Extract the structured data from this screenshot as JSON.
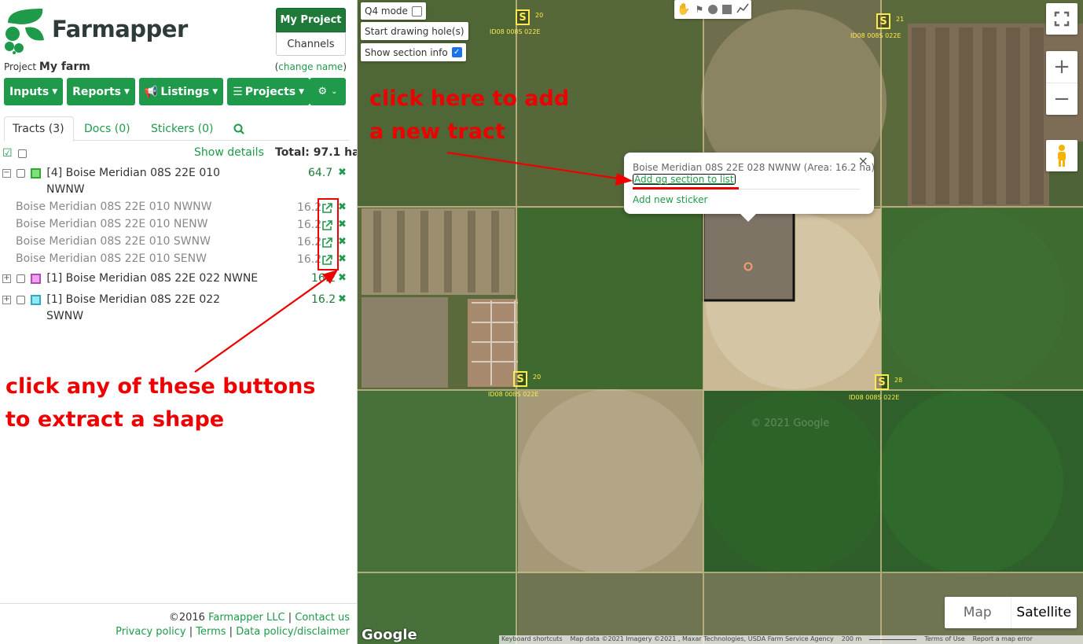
{
  "brand": {
    "name": "Farmapper"
  },
  "header": {
    "my_project": "My Project",
    "channels": "Channels"
  },
  "project": {
    "label": "Project",
    "name": "My farm",
    "change_name_prefix": "(",
    "change_name": "change name",
    "change_name_suffix": ")"
  },
  "menu": {
    "items": [
      "Inputs",
      "Reports",
      "Listings",
      "Projects"
    ]
  },
  "tabs": [
    {
      "label": "Tracts (3)"
    },
    {
      "label": "Docs  (0)"
    },
    {
      "label": "Stickers  (0)"
    }
  ],
  "tract_list": {
    "show_details": "Show details",
    "total_label": "Total: 97.1 ha",
    "groups": [
      {
        "expander": "−",
        "name_line1": "[4] Boise Meridian 08S 22E 010",
        "name_line2": "NWNW",
        "area": "64.7",
        "color": "#4bd04b"
      },
      {
        "expander": "+",
        "name_line1": "[1] Boise Meridian 08S 22E 022 NWNE",
        "name_line2": "",
        "area": "16.2",
        "color": "#e87de8"
      },
      {
        "expander": "+",
        "name_line1": "[1] Boise Meridian 08S 22E 022",
        "name_line2": "SWNW",
        "area": "16.2",
        "color": "#5fd7e8"
      }
    ],
    "subitems": [
      {
        "name": "Boise Meridian 08S 22E 010 NWNW",
        "area": "16.2"
      },
      {
        "name": "Boise Meridian 08S 22E 010 NENW",
        "area": "16.2"
      },
      {
        "name": "Boise Meridian 08S 22E 010 SWNW",
        "area": "16.2"
      },
      {
        "name": "Boise Meridian 08S 22E 010 SENW",
        "area": "16.2"
      }
    ]
  },
  "annotations": {
    "left_line1": "click any of these buttons",
    "left_line2": "to extract a shape",
    "map_line1": "click here to add",
    "map_line2": "a new tract"
  },
  "footer": {
    "copyright": "©2016 ",
    "company": "Farmapper LLC",
    "sep1": " | ",
    "contact": "Contact us",
    "privacy": "Privacy policy",
    "sep2": " | ",
    "terms": "Terms",
    "sep3": " | ",
    "data_policy": "Data policy/disclaimer"
  },
  "map": {
    "q4_mode": "Q4 mode",
    "start_drawing": "Start drawing hole(s)",
    "show_section_info": "Show section info",
    "show_section_info_checked": true,
    "popup": {
      "title": "Boise Meridian 08S 22E 028 NWNW (Area: 16.2 ha)",
      "add_section": "Add qq section to list",
      "add_sticker": "Add new sticker",
      "close": "×"
    },
    "map_type": {
      "map": "Map",
      "satellite": "Satellite"
    },
    "google": "Google",
    "watermark": "© 2021 Google",
    "attribution": {
      "shortcuts": "Keyboard shortcuts",
      "data": "Map data ©2021 Imagery ©2021 , Maxar Technologies, USDA Farm Service Agency",
      "scale": "200 m",
      "terms": "Terms of Use",
      "report": "Report a map error"
    },
    "sections": [
      {
        "num": "20",
        "label": "ID08 008S 022E"
      },
      {
        "num": "21",
        "label": "ID08 008S 022E"
      },
      {
        "num": "20",
        "label": "ID08 008S 022E"
      },
      {
        "num": "28",
        "label": "ID08 008S 022E"
      }
    ]
  }
}
